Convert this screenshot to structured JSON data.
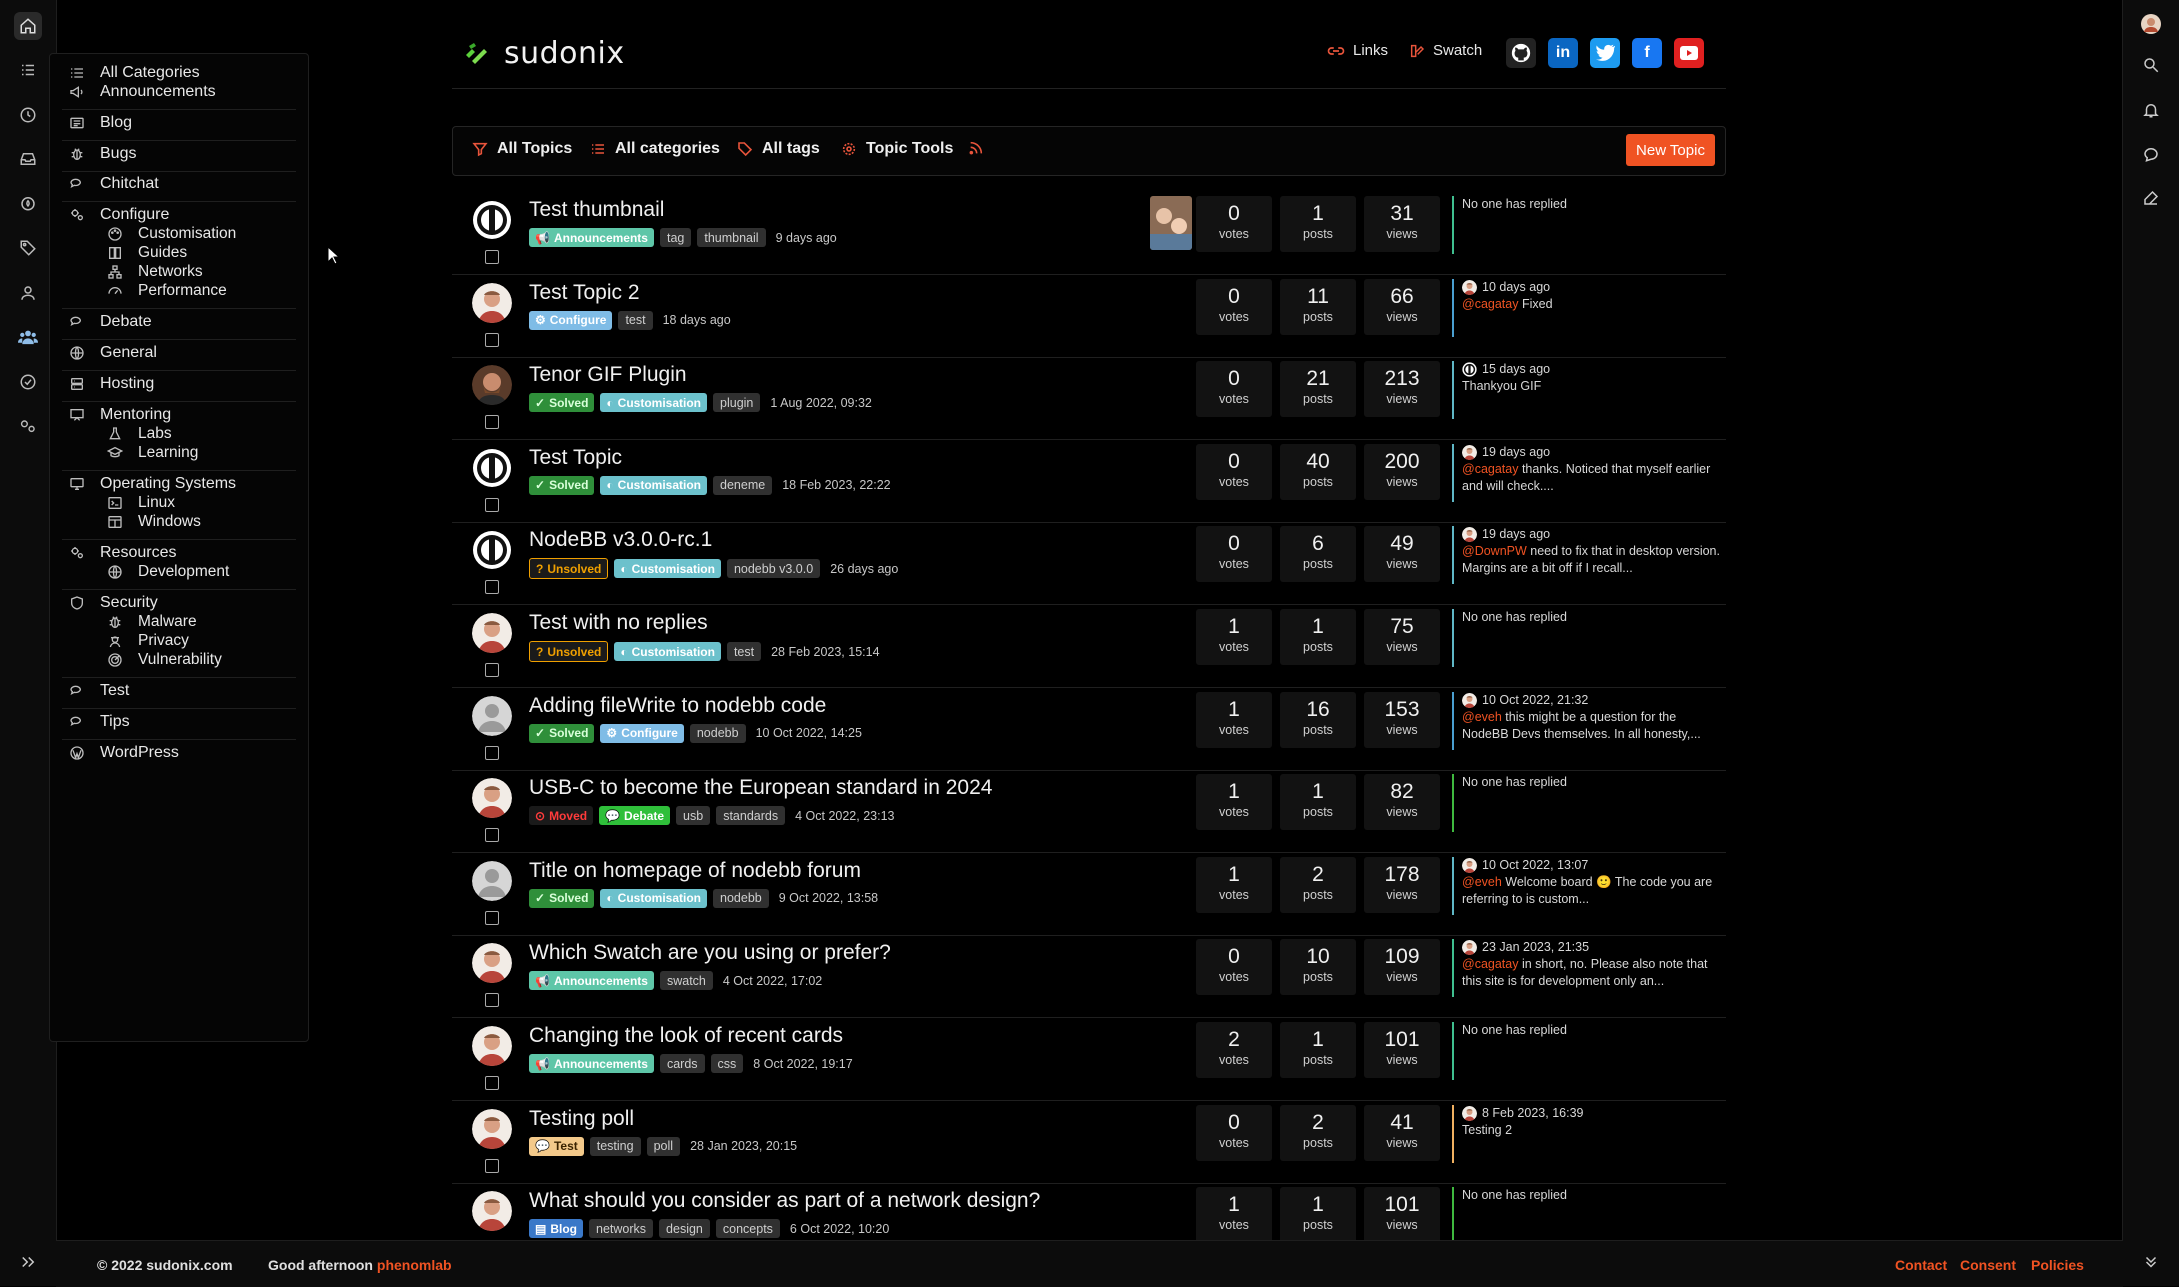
{
  "brand": {
    "name": "sudonix"
  },
  "header_links": [
    {
      "label": "Links"
    },
    {
      "label": "Swatch"
    }
  ],
  "social": [
    {
      "name": "github-icon",
      "color": "#2b2b2b"
    },
    {
      "name": "linkedin-icon",
      "color": "#0a66c2"
    },
    {
      "name": "twitter-icon",
      "color": "#1d9bf0"
    },
    {
      "name": "facebook-icon",
      "color": "#1877f2"
    },
    {
      "name": "youtube-icon",
      "color": "#e02020"
    }
  ],
  "toolbar": {
    "all_topics": "All Topics",
    "all_categories": "All categories",
    "all_tags": "All tags",
    "topic_tools": "Topic Tools",
    "new_topic": "New Topic"
  },
  "categories": [
    {
      "label": "All Categories",
      "icon": "list-icon"
    },
    {
      "label": "Announcements",
      "icon": "bullhorn-icon"
    },
    {
      "label": "Blog",
      "icon": "newspaper-icon"
    },
    {
      "label": "Bugs",
      "icon": "bug-icon"
    },
    {
      "label": "Chitchat",
      "icon": "comments-icon"
    },
    {
      "label": "Configure",
      "icon": "cogs-icon"
    },
    {
      "label": "Customisation",
      "icon": "palette-icon"
    },
    {
      "label": "Guides",
      "icon": "book-icon"
    },
    {
      "label": "Networks",
      "icon": "network-icon"
    },
    {
      "label": "Performance",
      "icon": "gauge-icon"
    },
    {
      "label": "Debate",
      "icon": "comments-icon"
    },
    {
      "label": "General",
      "icon": "globe-icon"
    },
    {
      "label": "Hosting",
      "icon": "server-icon"
    },
    {
      "label": "Mentoring",
      "icon": "chalkboard-icon"
    },
    {
      "label": "Labs",
      "icon": "flask-icon"
    },
    {
      "label": "Learning",
      "icon": "graduation-icon"
    },
    {
      "label": "Operating Systems",
      "icon": "desktop-icon"
    },
    {
      "label": "Linux",
      "icon": "terminal-icon"
    },
    {
      "label": "Windows",
      "icon": "window-icon"
    },
    {
      "label": "Resources",
      "icon": "cogs-icon"
    },
    {
      "label": "Development",
      "icon": "globe-icon"
    },
    {
      "label": "Security",
      "icon": "shield-icon"
    },
    {
      "label": "Malware",
      "icon": "bug-icon"
    },
    {
      "label": "Privacy",
      "icon": "user-secret-icon"
    },
    {
      "label": "Vulnerability",
      "icon": "radar-icon"
    },
    {
      "label": "Test",
      "icon": "comments-icon"
    },
    {
      "label": "Tips",
      "icon": "comments-icon"
    },
    {
      "label": "WordPress",
      "icon": "wordpress-icon"
    }
  ],
  "topics": [
    {
      "title": "Test thumbnail",
      "avatar": "logo",
      "badges": [
        {
          "text": "Announcements",
          "kind": "announce"
        }
      ],
      "tags": [
        "tag",
        "thumbnail"
      ],
      "time": "9 days ago",
      "thumb": true,
      "votes": "0",
      "posts": "1",
      "views": "31",
      "teaser": {
        "time": "",
        "avatar": "",
        "mention": "",
        "text": "No one has replied"
      },
      "accent": "#3fbf8f"
    },
    {
      "title": "Test Topic 2",
      "avatar": "man",
      "badges": [
        {
          "text": "Configure",
          "kind": "configure"
        }
      ],
      "tags": [
        "test"
      ],
      "time": "18 days ago",
      "votes": "0",
      "posts": "11",
      "views": "66",
      "teaser": {
        "time": "10 days ago",
        "avatar": "man",
        "mention": "@cagatay",
        "text": " Fixed"
      },
      "accent": "#4a9fd0"
    },
    {
      "title": "Tenor GIF Plugin",
      "avatar": "beard",
      "badges": [
        {
          "text": "Solved",
          "kind": "solved"
        },
        {
          "text": "Customisation",
          "kind": "custom"
        }
      ],
      "tags": [
        "plugin"
      ],
      "time": "1 Aug 2022, 09:32",
      "votes": "0",
      "posts": "21",
      "views": "213",
      "teaser": {
        "time": "15 days ago",
        "avatar": "logo",
        "mention": "",
        "text": "Thankyou GIF"
      },
      "accent": "#5fb7c6"
    },
    {
      "title": "Test Topic",
      "avatar": "logo",
      "badges": [
        {
          "text": "Solved",
          "kind": "solved"
        },
        {
          "text": "Customisation",
          "kind": "custom"
        }
      ],
      "tags": [
        "deneme"
      ],
      "time": "18 Feb 2023, 22:22",
      "votes": "0",
      "posts": "40",
      "views": "200",
      "teaser": {
        "time": "19 days ago",
        "avatar": "man",
        "mention": "@cagatay",
        "text": " thanks. Noticed that myself earlier and will check...."
      },
      "accent": "#5fb7c6"
    },
    {
      "title": "NodeBB v3.0.0-rc.1",
      "avatar": "logo",
      "badges": [
        {
          "text": "Unsolved",
          "kind": "unsolved"
        },
        {
          "text": "Customisation",
          "kind": "custom"
        }
      ],
      "tags": [
        "nodebb v3.0.0"
      ],
      "time": "26 days ago",
      "votes": "0",
      "posts": "6",
      "views": "49",
      "teaser": {
        "time": "19 days ago",
        "avatar": "man",
        "mention": "@DownPW",
        "text": " need to fix that in desktop version. Margins are a bit off if I recall..."
      },
      "accent": "#5fb7c6"
    },
    {
      "title": "Test with no replies",
      "avatar": "man",
      "badges": [
        {
          "text": "Unsolved",
          "kind": "unsolved"
        },
        {
          "text": "Customisation",
          "kind": "custom"
        }
      ],
      "tags": [
        "test"
      ],
      "time": "28 Feb 2023, 15:14",
      "votes": "1",
      "posts": "1",
      "views": "75",
      "teaser": {
        "time": "",
        "avatar": "",
        "mention": "",
        "text": "No one has replied"
      },
      "accent": "#5fb7c6"
    },
    {
      "title": "Adding fileWrite to nodebb code",
      "avatar": "grey",
      "badges": [
        {
          "text": "Solved",
          "kind": "solved"
        },
        {
          "text": "Configure",
          "kind": "configure"
        }
      ],
      "tags": [
        "nodebb"
      ],
      "time": "10 Oct 2022, 14:25",
      "votes": "1",
      "posts": "16",
      "views": "153",
      "teaser": {
        "time": "10 Oct 2022, 21:32",
        "avatar": "man",
        "mention": "@eveh",
        "text": " this might be a question for the NodeBB Devs themselves. In all honesty,..."
      },
      "accent": "#4a9fd0"
    },
    {
      "title": "USB-C to become the European standard in 2024",
      "avatar": "man",
      "badges": [
        {
          "text": "Moved",
          "kind": "moved"
        },
        {
          "text": "Debate",
          "kind": "debate"
        }
      ],
      "tags": [
        "usb",
        "standards"
      ],
      "time": "4 Oct 2022, 23:13",
      "votes": "1",
      "posts": "1",
      "views": "82",
      "teaser": {
        "time": "",
        "avatar": "",
        "mention": "",
        "text": "No one has replied"
      },
      "accent": "#3fb93f"
    },
    {
      "title": "Title on homepage of nodebb forum",
      "avatar": "grey",
      "badges": [
        {
          "text": "Solved",
          "kind": "solved"
        },
        {
          "text": "Customisation",
          "kind": "custom"
        }
      ],
      "tags": [
        "nodebb"
      ],
      "time": "9 Oct 2022, 13:58",
      "votes": "1",
      "posts": "2",
      "views": "178",
      "teaser": {
        "time": "10 Oct 2022, 13:07",
        "avatar": "man",
        "mention": "@eveh",
        "text": " Welcome board 🙂 The code you are referring to is custom..."
      },
      "accent": "#5fb7c6"
    },
    {
      "title": "Which Swatch are you using or prefer?",
      "avatar": "man",
      "badges": [
        {
          "text": "Announcements",
          "kind": "announce"
        }
      ],
      "tags": [
        "swatch"
      ],
      "time": "4 Oct 2022, 17:02",
      "votes": "0",
      "posts": "10",
      "views": "109",
      "teaser": {
        "time": "23 Jan 2023, 21:35",
        "avatar": "man",
        "mention": "@cagatay",
        "text": " in short, no. Please also note that this site is for development only an..."
      },
      "accent": "#3fbf8f"
    },
    {
      "title": "Changing the look of recent cards",
      "avatar": "man",
      "badges": [
        {
          "text": "Announcements",
          "kind": "announce"
        }
      ],
      "tags": [
        "cards",
        "css"
      ],
      "time": "8 Oct 2022, 19:17",
      "votes": "2",
      "posts": "1",
      "views": "101",
      "teaser": {
        "time": "",
        "avatar": "",
        "mention": "",
        "text": "No one has replied"
      },
      "accent": "#3fbf8f"
    },
    {
      "title": "Testing poll",
      "avatar": "man",
      "badges": [
        {
          "text": "Test",
          "kind": "test"
        }
      ],
      "tags": [
        "testing",
        "poll"
      ],
      "time": "28 Jan 2023, 20:15",
      "votes": "0",
      "posts": "2",
      "views": "41",
      "teaser": {
        "time": "8 Feb 2023, 16:39",
        "avatar": "man",
        "mention": "",
        "text": "Testing 2"
      },
      "accent": "#f0b060"
    },
    {
      "title": "What should you consider as part of a network design?",
      "avatar": "man",
      "badges": [
        {
          "text": "Blog",
          "kind": "blog"
        }
      ],
      "tags": [
        "networks",
        "design",
        "concepts"
      ],
      "time": "6 Oct 2022, 10:20",
      "votes": "1",
      "posts": "1",
      "views": "101",
      "teaser": {
        "time": "",
        "avatar": "",
        "mention": "",
        "text": "No one has replied"
      },
      "accent": "#3fb93f"
    }
  ],
  "stat_labels": {
    "votes": "votes",
    "posts": "posts",
    "views": "views"
  },
  "footer": {
    "copyright": "© 2022 sudonix.com",
    "greeting": "Good afternoon",
    "username": "phenomlab",
    "links": [
      "Contact",
      "Consent",
      "Policies"
    ]
  },
  "colors": {
    "accent": "#f05323",
    "background": "#000000"
  }
}
